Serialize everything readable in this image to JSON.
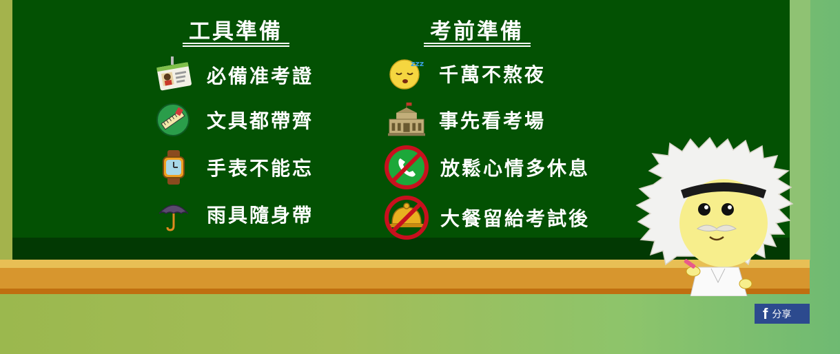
{
  "columns": [
    {
      "title": "工具準備",
      "items": [
        {
          "label": "必備准考證",
          "icon": "id-card-icon"
        },
        {
          "label": "文具都帶齊",
          "icon": "stationery-icon"
        },
        {
          "label": "手表不能忘",
          "icon": "watch-icon"
        },
        {
          "label": "雨具隨身帶",
          "icon": "umbrella-icon"
        }
      ]
    },
    {
      "title": "考前準備",
      "items": [
        {
          "label": "千萬不熬夜",
          "icon": "sleeping-face-icon"
        },
        {
          "label": "事先看考場",
          "icon": "building-icon"
        },
        {
          "label": "放鬆心情多休息",
          "icon": "no-phone-icon"
        },
        {
          "label": "大餐留給考試後",
          "icon": "no-feast-icon"
        }
      ]
    }
  ],
  "share": {
    "icon": "facebook-icon",
    "label": "分享"
  },
  "colors": {
    "board": "#035103",
    "share": "#2c4a8e",
    "ledge": "#d7962e"
  }
}
